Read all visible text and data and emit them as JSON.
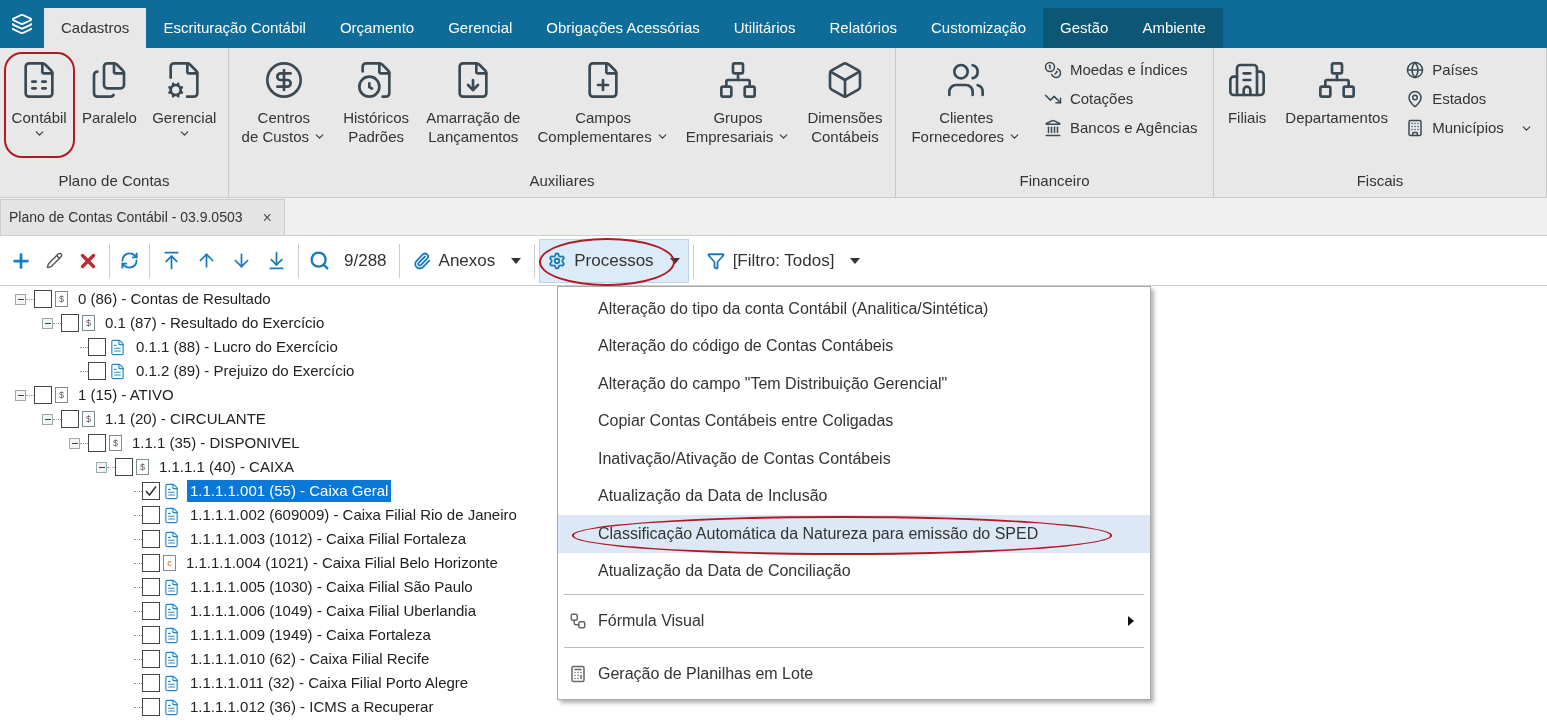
{
  "menu_bar": {
    "tabs": [
      {
        "label": "Cadastros",
        "selected": true,
        "context": false
      },
      {
        "label": "Escrituração Contábil",
        "selected": false,
        "context": false
      },
      {
        "label": "Orçamento",
        "selected": false,
        "context": false
      },
      {
        "label": "Gerencial",
        "selected": false,
        "context": false
      },
      {
        "label": "Obrigações Acessórias",
        "selected": false,
        "context": false
      },
      {
        "label": "Utilitários",
        "selected": false,
        "context": false
      },
      {
        "label": "Relatórios",
        "selected": false,
        "context": false
      },
      {
        "label": "Customização",
        "selected": false,
        "context": false
      },
      {
        "label": "Gestão",
        "selected": false,
        "context": true
      },
      {
        "label": "Ambiente",
        "selected": false,
        "context": true
      }
    ]
  },
  "ribbon": {
    "groups": [
      {
        "label": "Plano de Contas",
        "columns": [
          {
            "kind": "large",
            "lines": [
              "Contábil"
            ],
            "dropdown": true,
            "circled": true
          },
          {
            "kind": "large",
            "lines": [
              "Paralelo"
            ],
            "dropdown": false,
            "circled": false
          },
          {
            "kind": "large",
            "lines": [
              "Gerencial"
            ],
            "dropdown": true,
            "circled": false
          }
        ]
      },
      {
        "label": "Auxiliares",
        "columns": [
          {
            "kind": "large",
            "lines": [
              "Centros",
              "de Custos"
            ],
            "dropdown": true,
            "circled": false
          },
          {
            "kind": "large",
            "lines": [
              "Históricos",
              "Padrões"
            ],
            "dropdown": false,
            "circled": false
          },
          {
            "kind": "large",
            "lines": [
              "Amarração de",
              "Lançamentos"
            ],
            "dropdown": false,
            "circled": false
          },
          {
            "kind": "large",
            "lines": [
              "Campos",
              "Complementares"
            ],
            "dropdown": true,
            "circled": false
          },
          {
            "kind": "large",
            "lines": [
              "Grupos",
              "Empresariais"
            ],
            "dropdown": true,
            "circled": false
          },
          {
            "kind": "large",
            "lines": [
              "Dimensões",
              "Contábeis"
            ],
            "dropdown": false,
            "circled": false
          }
        ]
      },
      {
        "label": "Financeiro",
        "columns": [
          {
            "kind": "large",
            "lines": [
              "Clientes",
              "Fornecedores"
            ],
            "dropdown": true,
            "circled": false
          },
          {
            "kind": "small",
            "items": [
              {
                "label": "Moedas e Índices",
                "dropdown": false
              },
              {
                "label": "Cotações",
                "dropdown": false
              },
              {
                "label": "Bancos e Agências",
                "dropdown": false
              }
            ]
          }
        ]
      },
      {
        "label": "Fiscais",
        "columns": [
          {
            "kind": "large",
            "lines": [
              "Filiais"
            ],
            "dropdown": false,
            "circled": false
          },
          {
            "kind": "large",
            "lines": [
              "Departamentos"
            ],
            "dropdown": false,
            "circled": false
          },
          {
            "kind": "small",
            "items": [
              {
                "label": "Países",
                "dropdown": false
              },
              {
                "label": "Estados",
                "dropdown": false
              },
              {
                "label": "Municípios",
                "dropdown": true
              }
            ]
          }
        ]
      }
    ]
  },
  "document_tab": {
    "title": "Plano de Contas Contábil - 03.9.0503",
    "close": "×"
  },
  "toolbar": {
    "counter": "9/288",
    "buttons": [
      {
        "label": "Anexos",
        "dropdown": true,
        "selected": false,
        "circled": false
      },
      {
        "label": "Processos",
        "dropdown": true,
        "selected": true,
        "circled": true
      },
      {
        "label": "[Filtro: Todos]",
        "dropdown": true,
        "selected": false,
        "circled": false
      }
    ]
  },
  "tree": [
    {
      "label": "0 (86) - Contas de Resultado",
      "kind": "synthetic",
      "badge": "$",
      "checked": false,
      "selected": false,
      "expanded": true,
      "children": [
        {
          "label": "0.1 (87) - Resultado do Exercício",
          "kind": "synthetic",
          "badge": "$",
          "checked": false,
          "selected": false,
          "expanded": true,
          "children": [
            {
              "label": "0.1.1 (88) - Lucro do Exercício",
              "kind": "analytic",
              "checked": false,
              "selected": false
            },
            {
              "label": "0.1.2 (89) - Prejuizo do Exercício",
              "kind": "analytic",
              "checked": false,
              "selected": false
            }
          ]
        }
      ]
    },
    {
      "label": "1 (15) - ATIVO",
      "kind": "synthetic",
      "badge": "$",
      "checked": false,
      "selected": false,
      "expanded": true,
      "children": [
        {
          "label": "1.1 (20) - CIRCULANTE",
          "kind": "synthetic",
          "badge": "$",
          "checked": false,
          "selected": false,
          "expanded": true,
          "children": [
            {
              "label": "1.1.1 (35) - DISPONIVEL",
              "kind": "synthetic",
              "badge": "$",
              "checked": false,
              "selected": false,
              "expanded": true,
              "children": [
                {
                  "label": "1.1.1.1 (40) - CAIXA",
                  "kind": "synthetic",
                  "badge": "$",
                  "checked": false,
                  "selected": false,
                  "expanded": true,
                  "children": [
                    {
                      "label": "1.1.1.1.001 (55) - Caixa Geral",
                      "kind": "analytic",
                      "checked": true,
                      "selected": true
                    },
                    {
                      "label": "1.1.1.1.002 (609009) - Caixa Filial Rio de Janeiro",
                      "kind": "analytic",
                      "checked": false,
                      "selected": false
                    },
                    {
                      "label": "1.1.1.1.003 (1012) - Caixa Filial Fortaleza",
                      "kind": "analytic",
                      "checked": false,
                      "selected": false
                    },
                    {
                      "label": "1.1.1.1.004 (1021) - Caixa Filial Belo Horizonte",
                      "kind": "compensation",
                      "badge": "c",
                      "checked": false,
                      "selected": false
                    },
                    {
                      "label": "1.1.1.1.005 (1030) - Caixa Filial São Paulo",
                      "kind": "analytic",
                      "checked": false,
                      "selected": false
                    },
                    {
                      "label": "1.1.1.1.006 (1049) - Caixa Filial Uberlandia",
                      "kind": "analytic",
                      "checked": false,
                      "selected": false
                    },
                    {
                      "label": "1.1.1.1.009 (1949) - Caixa Fortaleza",
                      "kind": "analytic",
                      "checked": false,
                      "selected": false
                    },
                    {
                      "label": "1.1.1.1.010 (62) - Caixa Filial Recife",
                      "kind": "analytic",
                      "checked": false,
                      "selected": false
                    },
                    {
                      "label": "1.1.1.1.011 (32) - Caixa Filial Porto Alegre",
                      "kind": "analytic",
                      "checked": false,
                      "selected": false
                    },
                    {
                      "label": "1.1.1.1.012 (36) - ICMS a Recuperar",
                      "kind": "analytic",
                      "checked": false,
                      "selected": false
                    }
                  ]
                }
              ]
            }
          ]
        }
      ]
    }
  ],
  "process_menu": {
    "sections": [
      {
        "items": [
          {
            "label": "Alteração do tipo da conta Contábil (Analitica/Sintética)",
            "kind": "item",
            "selected": false,
            "circled": false
          },
          {
            "label": "Alteração do código de Contas Contábeis",
            "kind": "item",
            "selected": false,
            "circled": false
          },
          {
            "label": "Alteração do campo \"Tem Distribuição Gerencial\"",
            "kind": "item",
            "selected": false,
            "circled": false
          },
          {
            "label": "Copiar Contas Contábeis entre Coligadas",
            "kind": "item",
            "selected": false,
            "circled": false
          },
          {
            "label": "Inativação/Ativação de Contas Contábeis",
            "kind": "item",
            "selected": false,
            "circled": false
          },
          {
            "label": "Atualização da Data de Inclusão",
            "kind": "item",
            "selected": false,
            "circled": false
          },
          {
            "label": "Classificação Automática da Natureza para emissão do SPED",
            "kind": "item",
            "selected": true,
            "circled": true
          },
          {
            "label": "Atualização da Data de Conciliação",
            "kind": "item",
            "selected": false,
            "circled": false
          }
        ]
      },
      {
        "items": [
          {
            "label": "Fórmula Visual",
            "kind": "submenu",
            "selected": false,
            "circled": false
          }
        ]
      },
      {
        "items": [
          {
            "label": "Geração de Planilhas em Lote",
            "kind": "item",
            "selected": false,
            "circled": false
          }
        ]
      }
    ]
  }
}
